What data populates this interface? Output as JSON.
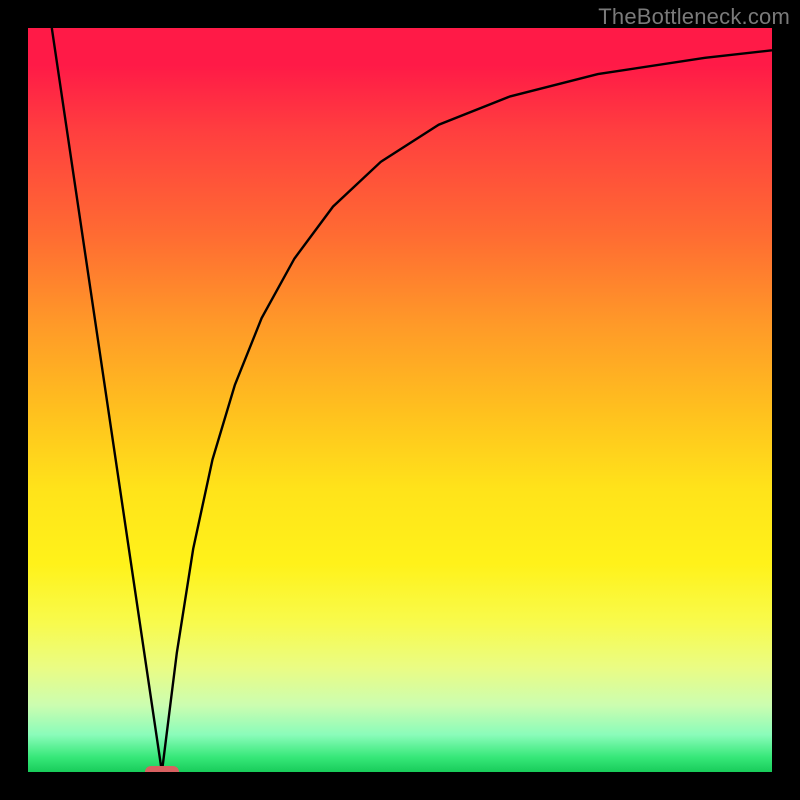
{
  "watermark": "TheBottleneck.com",
  "colors": {
    "frame": "#000000",
    "curve": "#000000",
    "marker": "#d86060"
  },
  "chart_data": {
    "type": "line",
    "title": "",
    "xlabel": "",
    "ylabel": "",
    "xlim": [
      0,
      1
    ],
    "ylim": [
      0,
      1
    ],
    "series": [
      {
        "name": "left-linear-drop",
        "x": [
          0.032,
          0.18
        ],
        "y": [
          1.0,
          0.0
        ]
      },
      {
        "name": "right-log-rise",
        "x": [
          0.18,
          0.2,
          0.222,
          0.248,
          0.278,
          0.314,
          0.358,
          0.41,
          0.474,
          0.552,
          0.648,
          0.766,
          0.91,
          1.0
        ],
        "y": [
          0.0,
          0.16,
          0.3,
          0.42,
          0.52,
          0.61,
          0.69,
          0.76,
          0.82,
          0.87,
          0.908,
          0.938,
          0.96,
          0.97
        ]
      }
    ],
    "marker": {
      "x": 0.18,
      "y": 0.0
    }
  }
}
